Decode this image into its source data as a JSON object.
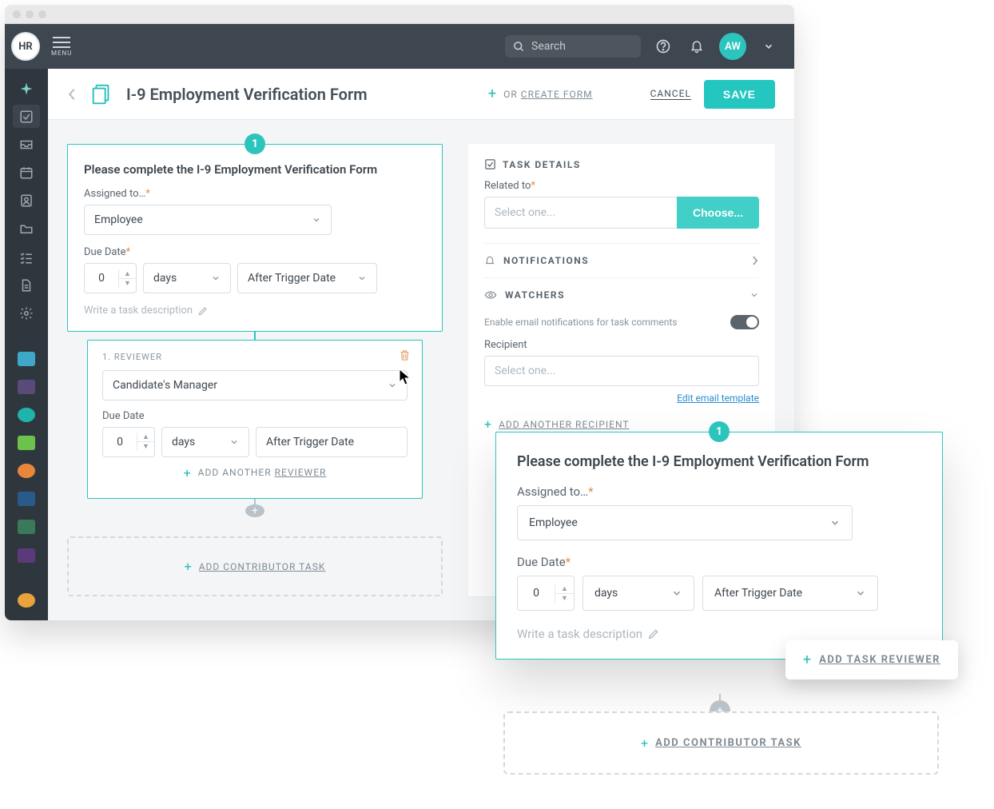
{
  "topbar": {
    "logo_text": "HR",
    "menu_label": "MENU",
    "search_placeholder": "Search",
    "avatar_initials": "AW"
  },
  "header": {
    "title": "I-9 Employment Verification Form",
    "or_create_label": "OR CREATE FORM",
    "cancel_label": "CANCEL",
    "save_label": "SAVE"
  },
  "task": {
    "badge": "1",
    "heading": "Please complete the I-9 Employment Verification Form",
    "assigned_label": "Assigned to…",
    "assigned_value": "Employee",
    "due_label": "Due Date",
    "due_number": "0",
    "due_unit": "days",
    "due_rel": "After Trigger Date",
    "desc_placeholder": "Write a task description"
  },
  "reviewer": {
    "title": "1. REVIEWER",
    "value": "Candidate's Manager",
    "due_label": "Due Date",
    "due_number": "0",
    "due_unit": "days",
    "due_rel": "After Trigger Date",
    "add_label": "ADD ANOTHER REVIEWER"
  },
  "contributor": {
    "add_label": "ADD CONTRIBUTOR TASK"
  },
  "details": {
    "section_title": "TASK DETAILS",
    "related_label": "Related to",
    "select_placeholder": "Select one...",
    "choose_label": "Choose...",
    "notifications_title": "NOTIFICATIONS",
    "watchers_title": "WATCHERS",
    "email_toggle_label": "Enable email notifications for task comments",
    "recipient_label": "Recipient",
    "recipient_placeholder": "Select one...",
    "edit_template_label": "Edit email template",
    "add_recipient_label": "ADD ANOTHER RECIPIENT"
  },
  "overlay": {
    "badge": "1",
    "heading": "Please complete the I-9 Employment Verification Form",
    "assigned_label": "Assigned to…",
    "assigned_value": "Employee",
    "due_label": "Due Date",
    "due_number": "0",
    "due_unit": "days",
    "due_rel": "After Trigger Date",
    "desc_placeholder": "Write a task description",
    "add_reviewer_label": "ADD TASK REVIEWER",
    "add_contributor_label": "ADD CONTRIBUTOR TASK"
  }
}
